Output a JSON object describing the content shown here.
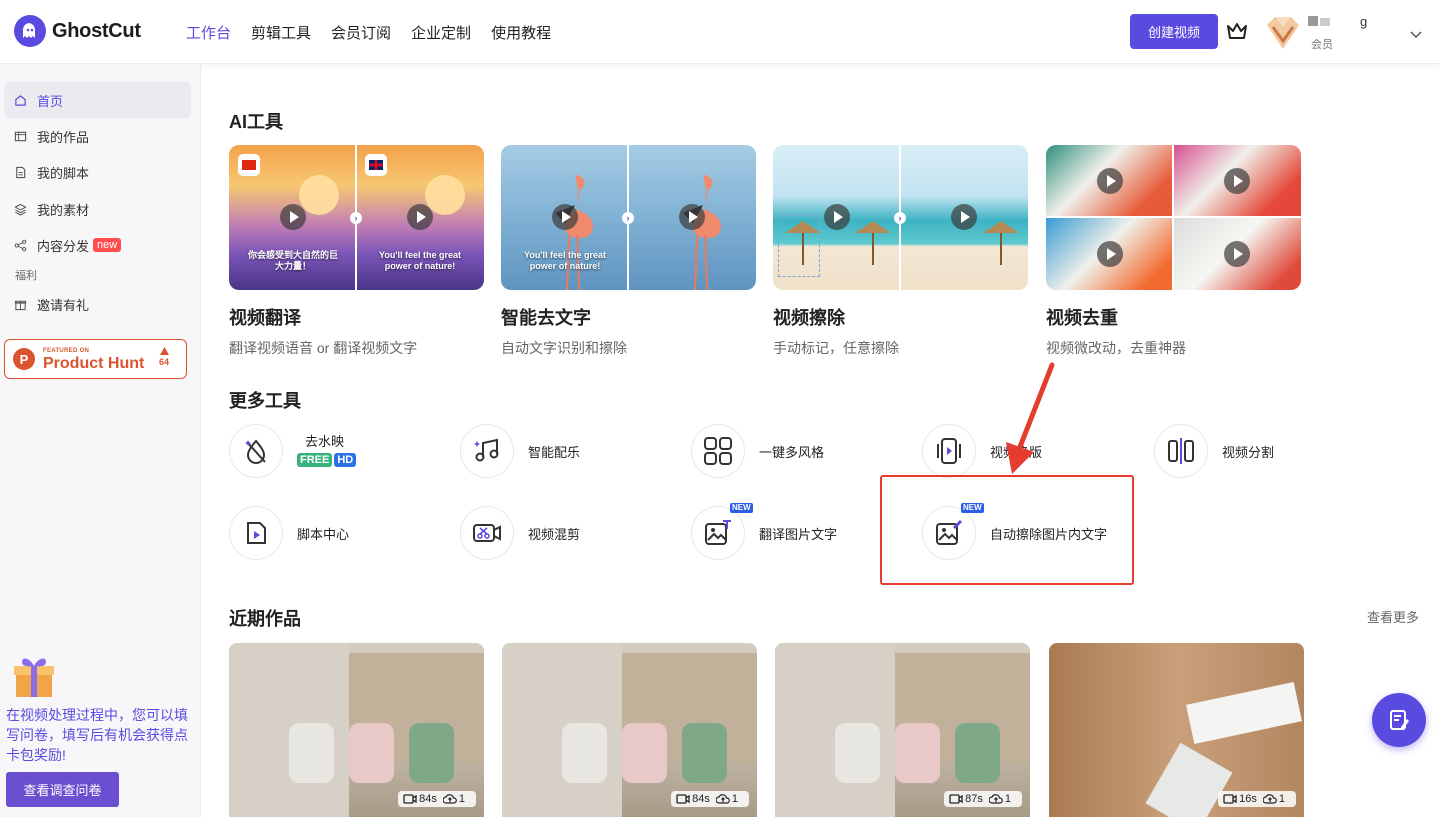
{
  "app": {
    "name": "GhostCut"
  },
  "nav": [
    "工作台",
    "剪辑工具",
    "会员订阅",
    "企业定制",
    "使用教程"
  ],
  "header": {
    "create_label": "创建视频",
    "user_name": "g",
    "user_role": "会员"
  },
  "sidebar": {
    "items": [
      {
        "label": "首页"
      },
      {
        "label": "我的作品"
      },
      {
        "label": "我的脚本"
      },
      {
        "label": "我的素材"
      },
      {
        "label": "内容分发",
        "badge": "new"
      }
    ],
    "category": "福利",
    "invite_label": "邀请有礼",
    "product_hunt": {
      "featured": "FEATURED ON",
      "name": "Product Hunt",
      "count": "64"
    },
    "survey_text": "在视频处理过程中，您可以填写问卷，填写后有机会获得点卡包奖励!",
    "survey_button": "查看调查问卷"
  },
  "ai_tools": {
    "title": "AI工具",
    "cards": [
      {
        "title": "视频翻译",
        "sub": "翻译视频语音 or 翻译视频文字",
        "caption_left": "你会感受到大自然的巨大力量！",
        "caption_right": "You'll feel the great power of nature!"
      },
      {
        "title": "智能去文字",
        "sub": "自动文字识别和擦除",
        "caption_left": "You'll feel the great power of nature!"
      },
      {
        "title": "视频擦除",
        "sub": "手动标记，任意擦除"
      },
      {
        "title": "视频去重",
        "sub": "视频微改动，去重神器"
      }
    ]
  },
  "more_tools": {
    "title": "更多工具",
    "items": [
      {
        "label": "去水映",
        "chips": [
          "FREE",
          "HD"
        ]
      },
      {
        "label": "智能配乐"
      },
      {
        "label": "一键多风格"
      },
      {
        "label": "视频换版"
      },
      {
        "label": "视频分割"
      },
      {
        "label": "脚本中心"
      },
      {
        "label": "视频混剪"
      },
      {
        "label": "翻译图片文字",
        "badge": "NEW"
      },
      {
        "label": "自动擦除图片内文字",
        "badge": "NEW"
      }
    ]
  },
  "recent": {
    "title": "近期作品",
    "more": "查看更多",
    "works": [
      {
        "duration": "84s",
        "count": "1"
      },
      {
        "duration": "84s",
        "count": "1"
      },
      {
        "duration": "87s",
        "count": "1"
      },
      {
        "duration": "16s",
        "count": "1"
      }
    ]
  }
}
